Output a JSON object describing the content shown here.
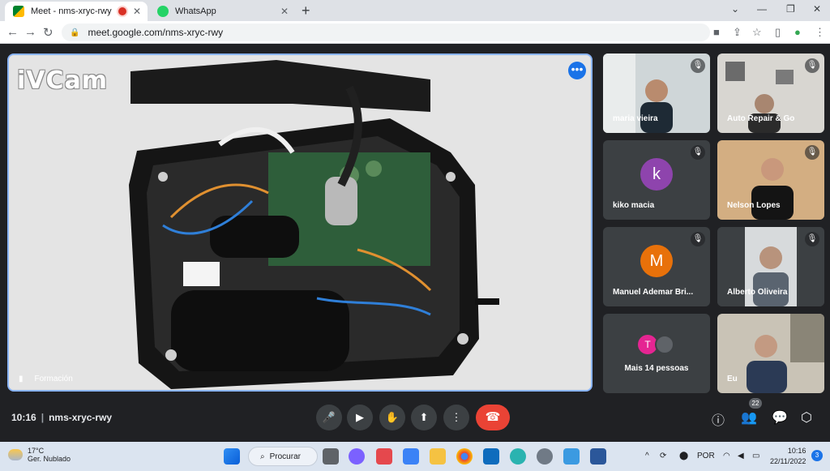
{
  "browser": {
    "tabs": [
      {
        "title": "Meet - nms-xryc-rwy",
        "active": true
      },
      {
        "title": "WhatsApp",
        "active": false
      }
    ],
    "url": "meet.google.com/nms-xryc-rwy"
  },
  "meet": {
    "presenter_name": "Formación",
    "watermark": "iVCam",
    "time": "10:16",
    "meeting_code": "nms-xryc-rwy",
    "participant_count": "22",
    "tiles": [
      {
        "name": "maria vieira",
        "type": "video"
      },
      {
        "name": "Auto Repair & Go",
        "type": "video"
      },
      {
        "name": "kiko macia",
        "type": "avatar",
        "initial": "k",
        "color": "#8e44ad"
      },
      {
        "name": "Nelson Lopes",
        "type": "video"
      },
      {
        "name": "Manuel Ademar Bri...",
        "type": "avatar",
        "initial": "M",
        "color": "#e8710a"
      },
      {
        "name": "Alberto Oliveira",
        "type": "video"
      },
      {
        "name": "Mais 14 pessoas",
        "type": "more",
        "initial": "T"
      },
      {
        "name": "Eu",
        "type": "video"
      }
    ]
  },
  "taskbar": {
    "weather_temp": "17°C",
    "weather_desc": "Ger. Nublado",
    "search_label": "Procurar",
    "language": "POR",
    "clock_time": "10:16",
    "clock_date": "22/11/2022",
    "notifications": "3"
  },
  "colors": {
    "accent": "#1a73e8",
    "hangup": "#ea4335",
    "meet_bg": "#202124",
    "tile_bg": "#3c4043",
    "speaking_border": "#8ab4f8"
  }
}
